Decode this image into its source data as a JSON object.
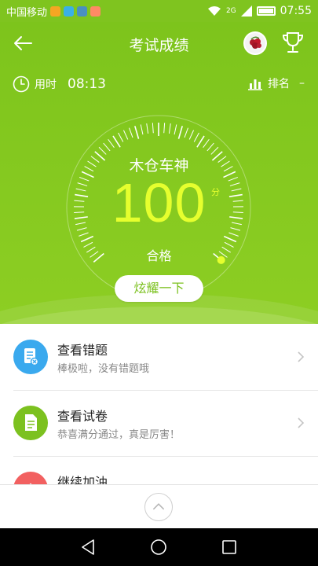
{
  "status_bar": {
    "carrier": "中国移动",
    "network": "2G",
    "time": "07:55"
  },
  "header": {
    "title": "考试成绩"
  },
  "stats": {
    "time_label": "用时",
    "time_value": "08:13",
    "rank_label": "排名",
    "rank_value": "–"
  },
  "result": {
    "user_name": "木仓车神",
    "score": "100",
    "score_unit": "分",
    "status": "合格",
    "share_button": "炫耀一下",
    "score_fraction": 1.0
  },
  "actions": [
    {
      "title": "查看错题",
      "subtitle": "棒极啦，没有错题哦",
      "icon": "wrong-questions-icon",
      "color": "#3aa9ee"
    },
    {
      "title": "查看试卷",
      "subtitle": "恭喜满分通过，真是厉害！",
      "icon": "exam-paper-icon",
      "color": "#7cc11f"
    },
    {
      "title": "继续加油",
      "subtitle": "",
      "icon": "cheer-icon",
      "color": "#f26060"
    }
  ],
  "colors": {
    "brand_green": "#7cc11f",
    "score_yellow": "#e6ff2e"
  }
}
